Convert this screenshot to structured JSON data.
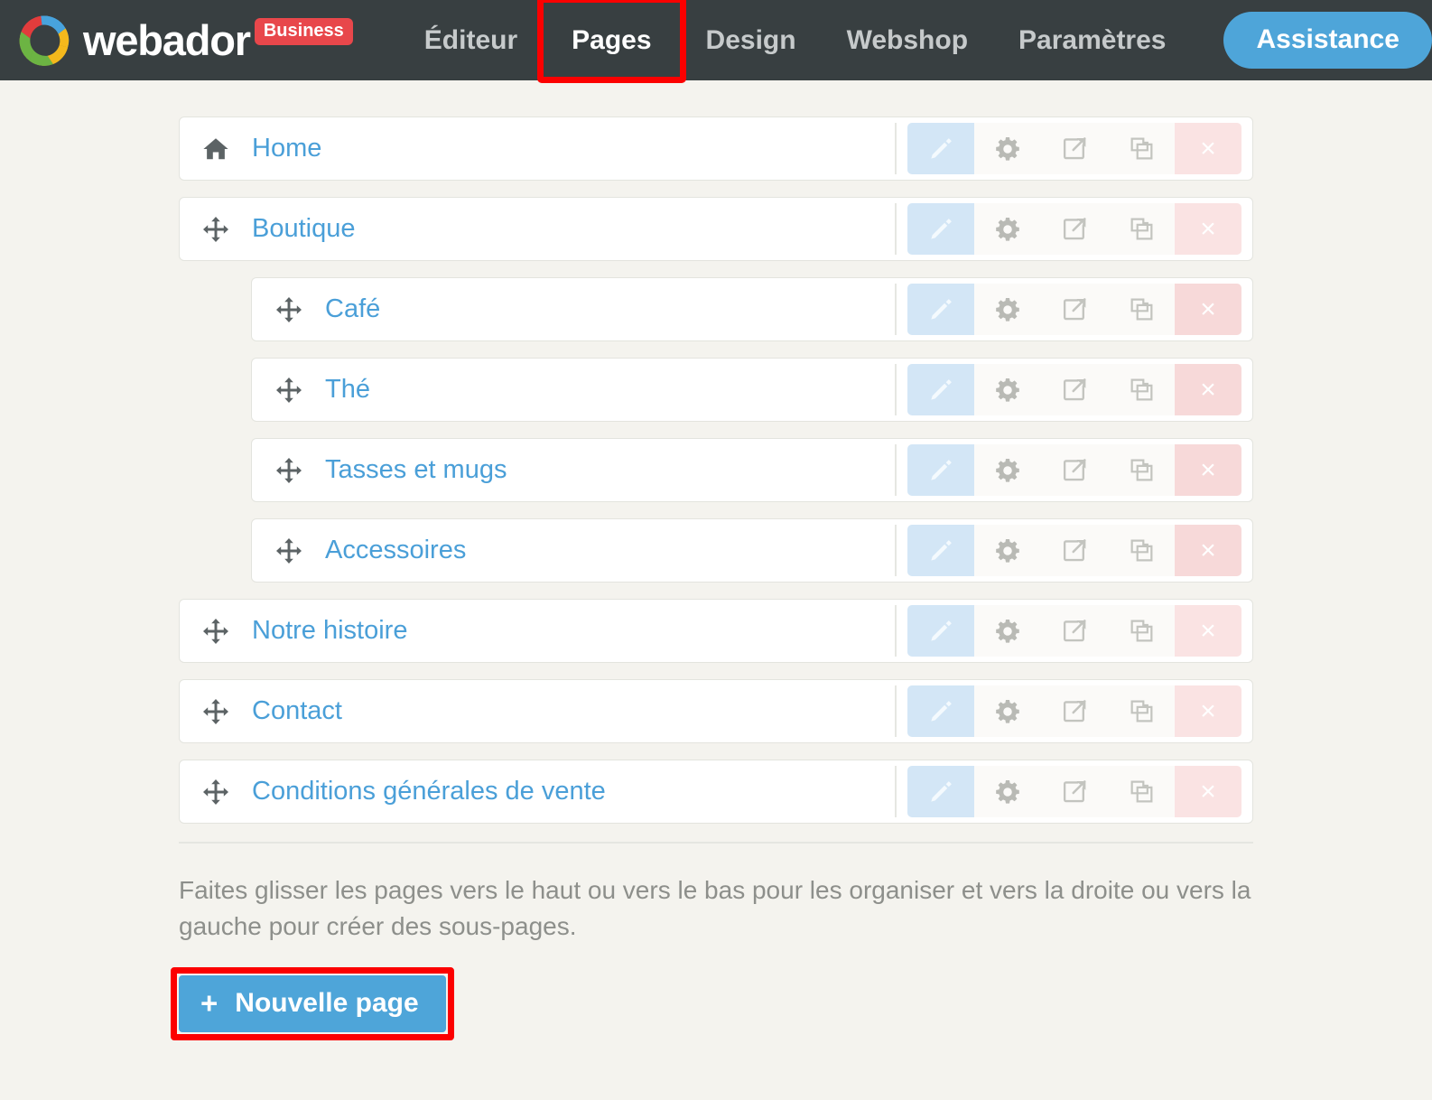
{
  "header": {
    "brand_name": "webador",
    "plan_badge": "Business",
    "logo_icon": "webador-aperture-logo",
    "nav": [
      {
        "label": "Éditeur",
        "active": false,
        "highlighted": false
      },
      {
        "label": "Pages",
        "active": true,
        "highlighted": true
      },
      {
        "label": "Design",
        "active": false,
        "highlighted": false
      },
      {
        "label": "Webshop",
        "active": false,
        "highlighted": false
      },
      {
        "label": "Paramètres",
        "active": false,
        "highlighted": false
      }
    ],
    "support_button": "Assistance",
    "colors": {
      "bar_background": "#383f41",
      "badge_red": "#e8474b",
      "accent_blue": "#4ea5d9",
      "nav_inactive": "#c6cacb",
      "nav_active": "#ffffff",
      "annotation_red": "#fc0000"
    }
  },
  "pages": [
    {
      "title": "Home",
      "level": 0,
      "handle_icon": "home-icon"
    },
    {
      "title": "Boutique",
      "level": 0,
      "handle_icon": "move-arrows-icon"
    },
    {
      "title": "Café",
      "level": 1,
      "handle_icon": "move-arrows-icon"
    },
    {
      "title": "Thé",
      "level": 1,
      "handle_icon": "move-arrows-icon"
    },
    {
      "title": "Tasses et mugs",
      "level": 1,
      "handle_icon": "move-arrows-icon"
    },
    {
      "title": "Accessoires",
      "level": 1,
      "handle_icon": "move-arrows-icon"
    },
    {
      "title": "Notre histoire",
      "level": 0,
      "handle_icon": "move-arrows-icon"
    },
    {
      "title": "Contact",
      "level": 0,
      "handle_icon": "move-arrows-icon"
    },
    {
      "title": "Conditions générales de vente",
      "level": 0,
      "handle_icon": "move-arrows-icon"
    }
  ],
  "row_actions": [
    {
      "name": "edit",
      "icon": "pencil-icon"
    },
    {
      "name": "settings",
      "icon": "gear-icon"
    },
    {
      "name": "preview",
      "icon": "external-link-icon"
    },
    {
      "name": "duplicate",
      "icon": "copy-icon"
    },
    {
      "name": "delete",
      "icon": "close-x-icon",
      "glyph": "×"
    }
  ],
  "footer": {
    "hint": "Faites glisser les pages vers le haut ou vers le bas pour les organiser et vers la droite ou vers la gauche pour créer des sous-pages.",
    "new_page_label": "Nouvelle page",
    "new_page_plus": "+",
    "new_page_highlighted": true
  },
  "page_background": "#f4f3ee",
  "link_blue": "#4a9fd8"
}
